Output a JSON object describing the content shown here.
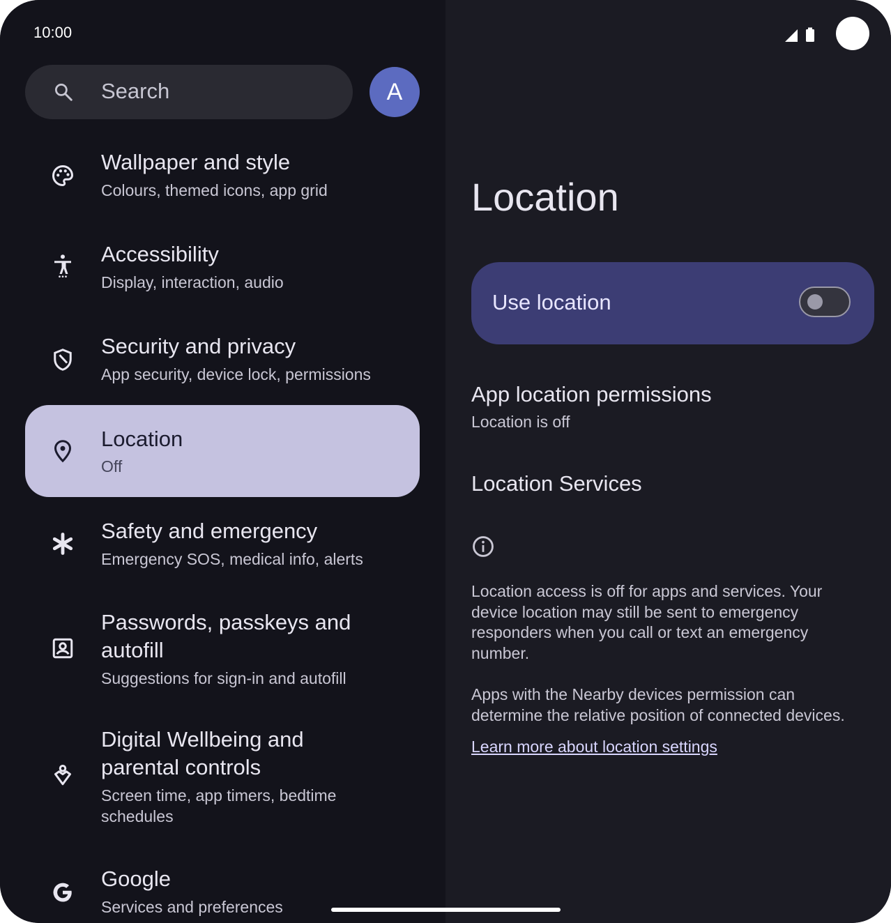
{
  "status_bar": {
    "time": "10:00",
    "icons": [
      "signal-icon",
      "battery-icon"
    ]
  },
  "search": {
    "label": "Search",
    "icon": "search-icon"
  },
  "avatar": {
    "initial": "A",
    "color": "#5c6bc0"
  },
  "sidebar": {
    "items": [
      {
        "title": "Wallpaper and style",
        "subtitle": "Colours, themed icons, app grid",
        "icon": "palette-icon",
        "selected": false
      },
      {
        "title": "Accessibility",
        "subtitle": "Display, interaction, audio",
        "icon": "accessibility-icon",
        "selected": false
      },
      {
        "title": "Security and privacy",
        "subtitle": "App security, device lock, permissions",
        "icon": "shield-icon",
        "selected": false
      },
      {
        "title": "Location",
        "subtitle": "Off",
        "icon": "location-pin-icon",
        "selected": true
      },
      {
        "title": "Safety and emergency",
        "subtitle": "Emergency SOS, medical info, alerts",
        "icon": "asterisk-icon",
        "selected": false
      },
      {
        "title_line1": "Passwords, passkeys and",
        "title_line2": "autofill",
        "subtitle": "Suggestions for sign-in and autofill",
        "icon": "account-box-icon",
        "selected": false
      },
      {
        "title_line1": "Digital Wellbeing and",
        "title_line2": "parental controls",
        "subtitle_line1": "Screen time, app timers, bedtime",
        "subtitle_line2": "schedules",
        "icon": "wellbeing-icon",
        "selected": false
      },
      {
        "title": "Google",
        "subtitle": "Services and preferences",
        "icon": "google-icon",
        "selected": false
      }
    ]
  },
  "detail": {
    "title": "Location",
    "use_location": {
      "label": "Use location",
      "enabled": false
    },
    "app_permissions": {
      "title": "App location permissions",
      "subtitle": "Location is off"
    },
    "location_services": {
      "title": "Location Services"
    },
    "info": {
      "icon": "info-icon",
      "paragraph1": [
        "Location access is off for apps and services. Your",
        "device location may still be sent to emergency",
        "responders when you call or text an emergency",
        "number."
      ],
      "paragraph2": [
        "Apps with the Nearby devices permission can",
        "determine the relative position of connected devices."
      ],
      "link": "Learn more about location settings"
    }
  },
  "colors": {
    "left_background": "#13131b",
    "right_background": "#1b1b23",
    "selected_item": "#c5c2e0",
    "use_location_card": "#3c3d74"
  }
}
